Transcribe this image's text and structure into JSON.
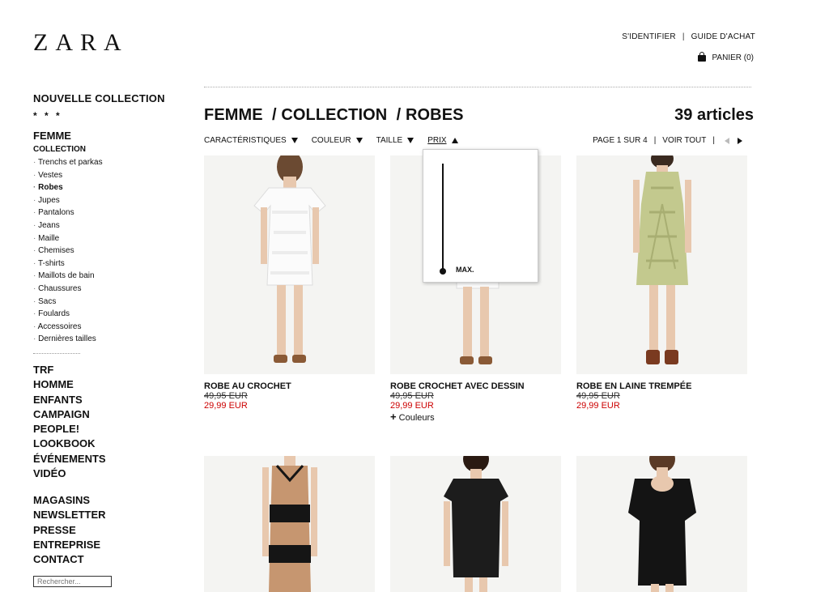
{
  "brand": {
    "logo": "ZARA"
  },
  "header": {
    "login": "S'IDENTIFIER",
    "separator": "|",
    "shopping_guide": "GUIDE D'ACHAT",
    "cart": "PANIER (0)"
  },
  "sidebar": {
    "nouvelle_collection": "NOUVELLE COLLECTION",
    "stars": "* * *",
    "femme": "FEMME",
    "collection": "COLLECTION",
    "subitems": [
      "Trenchs et parkas",
      "Vestes",
      "Robes",
      "Jupes",
      "Pantalons",
      "Jeans",
      "Maille",
      "Chemises",
      "T-shirts",
      "Maillots de bain",
      "Chaussures",
      "Sacs",
      "Foulards",
      "Accessoires",
      "Dernières tailles"
    ],
    "group1": [
      "TRF",
      "HOMME",
      "ENFANTS",
      "CAMPAIGN",
      "PEOPLE!",
      "LOOKBOOK",
      "ÉVÉNEMENTS",
      "VIDÉO"
    ],
    "group2": [
      "MAGASINS",
      "NEWSLETTER",
      "PRESSE",
      "ENTREPRISE",
      "CONTACT"
    ],
    "search_placeholder": "Rechercher..."
  },
  "main": {
    "breadcrumb": "FEMME  / COLLECTION  / ROBES",
    "count": "39 articles",
    "filters": [
      "CARACTÉRISTIQUES",
      "COULEUR",
      "TAILLE",
      "PRIX"
    ],
    "pager": {
      "page": "PAGE 1 SUR 4",
      "sep": "|",
      "view_all": "VOIR TOUT",
      "sep2": "|"
    },
    "price_dropdown": {
      "max_label": "MAX."
    }
  },
  "products": [
    {
      "name": "ROBE AU CROCHET",
      "old_price": "49,95 EUR",
      "price": "29,99 EUR"
    },
    {
      "name": "ROBE CROCHET AVEC DESSIN",
      "old_price": "49,95 EUR",
      "price": "29,99 EUR",
      "extra": "Couleurs",
      "extra_prefix": "+"
    },
    {
      "name": "ROBE EN LAINE TREMPÉE",
      "old_price": "49,95 EUR",
      "price": "29,99 EUR"
    }
  ],
  "colors": {
    "sale": "#cc0000",
    "text": "#111111"
  }
}
